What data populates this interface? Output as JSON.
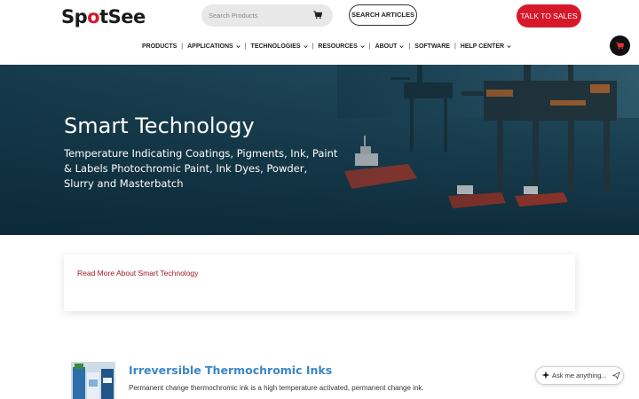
{
  "brand": {
    "logo_text_pre": "Sp",
    "logo_text_dot": "o",
    "logo_text_post": "tSee",
    "accent": "#d7182a"
  },
  "search": {
    "placeholder": "Search Products",
    "icon": "cart-icon"
  },
  "header_buttons": {
    "search_articles": "SEARCH ARTICLES",
    "talk_to_sales": "TALK TO SALES"
  },
  "nav": {
    "items": [
      {
        "label": "PRODUCTS",
        "dropdown": false
      },
      {
        "label": "APPLICATIONS",
        "dropdown": true
      },
      {
        "label": "TECHNOLOGIES",
        "dropdown": true
      },
      {
        "label": "RESOURCES",
        "dropdown": true
      },
      {
        "label": "ABOUT",
        "dropdown": true
      },
      {
        "label": "SOFTWARE",
        "dropdown": false
      },
      {
        "label": "HELP CENTER",
        "dropdown": true
      }
    ],
    "separator": "|"
  },
  "hero": {
    "title": "Smart Technology",
    "subtitle": "Temperature Indicating Coatings, Pigments, Ink, Paint & Labels Photochromic Paint, Ink Dyes, Powder, Slurry and Masterbatch"
  },
  "card": {
    "link": "Read More About Smart Technology",
    "link_color": "#a3161f"
  },
  "product": {
    "title": "Irreversible Thermochromic Inks",
    "description": "Permanent change thermochromic ink is a high temperature activated, permanent change ink.",
    "title_color": "#3b86c6"
  },
  "assistant": {
    "label": "Ask me anything..."
  }
}
